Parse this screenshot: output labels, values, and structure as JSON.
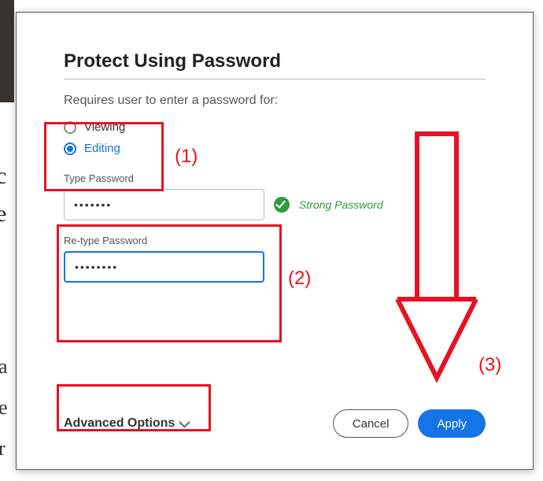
{
  "dialog": {
    "title": "Protect Using Password",
    "subtitle": "Requires user to enter a password for:",
    "radios": {
      "viewing": {
        "label": "Viewing",
        "checked": false
      },
      "editing": {
        "label": "Editing",
        "checked": true
      }
    },
    "password": {
      "label": "Type Password",
      "value": "•••••••",
      "strength_label": "Strong Password"
    },
    "retype": {
      "label": "Re-type Password",
      "value": "••••••••"
    },
    "advanced_label": "Advanced Options",
    "cancel_label": "Cancel",
    "apply_label": "Apply"
  },
  "annotations": {
    "label1": "(1)",
    "label2": "(2)",
    "label3": "(3)"
  },
  "bg_hints": {
    "left_top": "c\ne",
    "left_bottom": "a\ne\nr"
  }
}
